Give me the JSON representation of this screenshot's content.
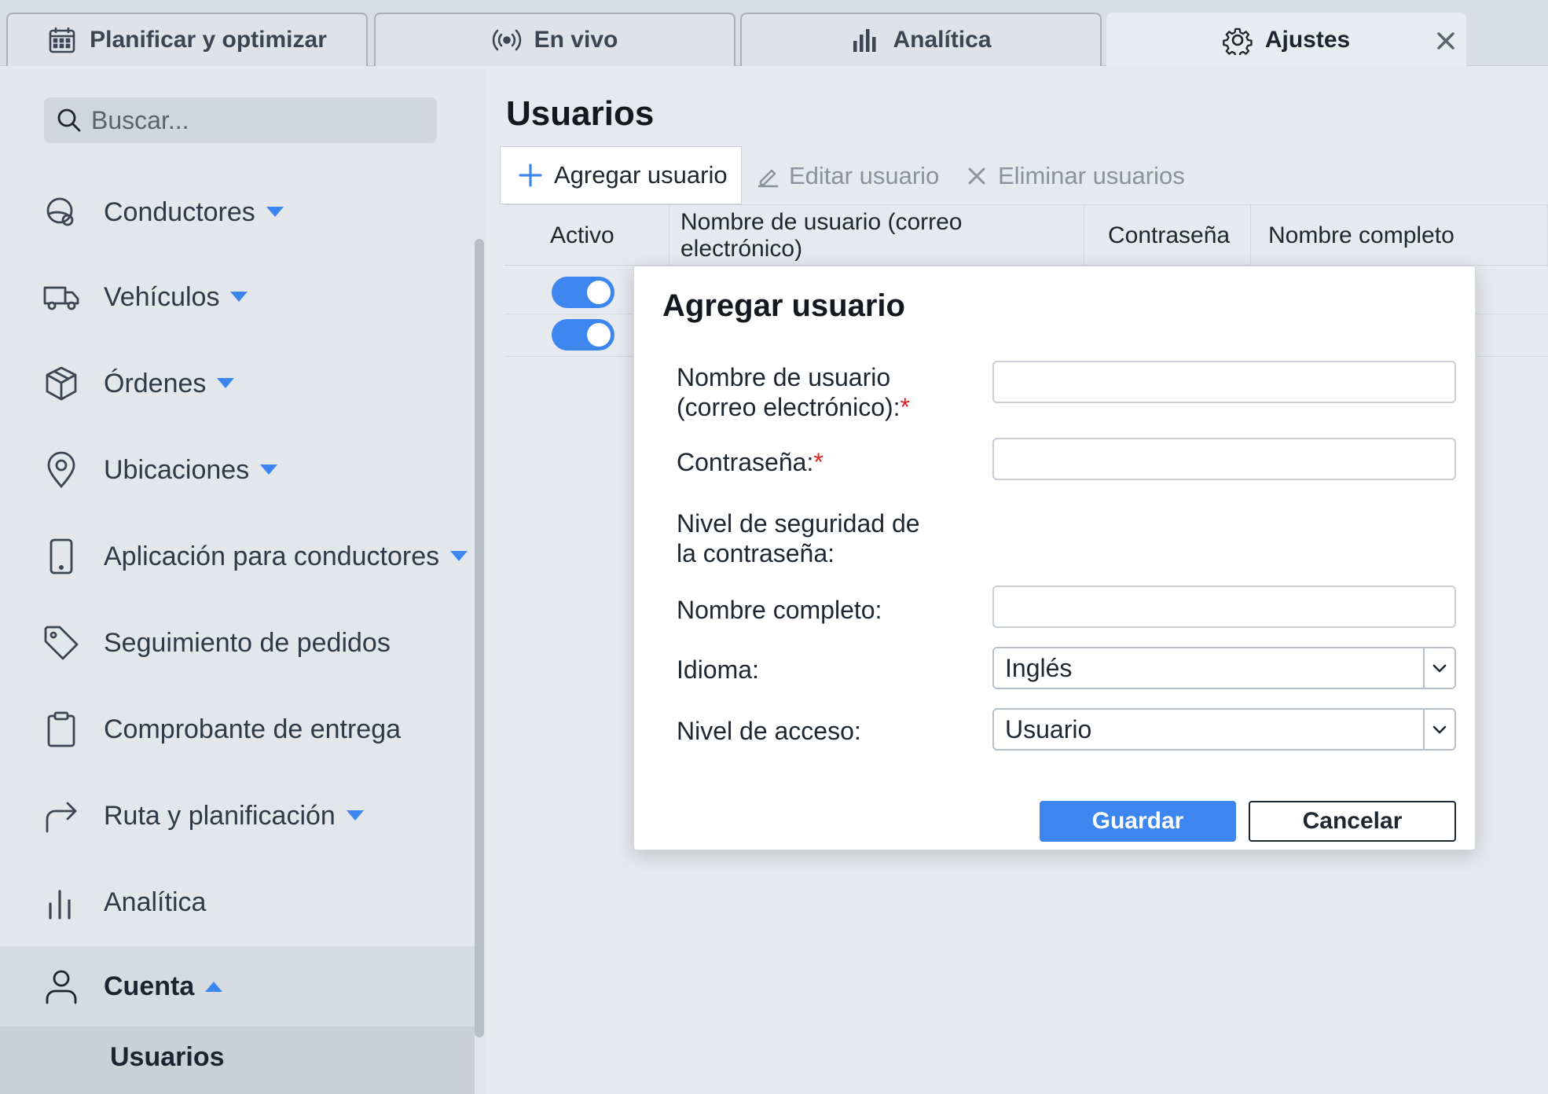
{
  "tabs": [
    {
      "label": "Planificar y optimizar",
      "icon": "calendar-icon"
    },
    {
      "label": "En vivo",
      "icon": "broadcast-icon"
    },
    {
      "label": "Analítica",
      "icon": "bar-chart-icon"
    },
    {
      "label": "Ajustes",
      "icon": "gear-icon",
      "active": true
    }
  ],
  "sidebar": {
    "search_placeholder": "Buscar...",
    "items": [
      {
        "label": "Conductores",
        "icon": "steering-icon"
      },
      {
        "label": "Vehículos",
        "icon": "truck-icon"
      },
      {
        "label": "Órdenes",
        "icon": "package-icon"
      },
      {
        "label": "Ubicaciones",
        "icon": "location-pin-icon"
      },
      {
        "label": "Aplicación para conductores",
        "icon": "mobile-icon"
      },
      {
        "label": "Seguimiento de pedidos",
        "icon": "tag-icon"
      },
      {
        "label": "Comprobante de entrega",
        "icon": "clipboard-icon"
      },
      {
        "label": "Ruta y planificación",
        "icon": "route-arrow-icon"
      },
      {
        "label": "Analítica",
        "icon": "bar-chart-icon"
      },
      {
        "label": "Cuenta",
        "icon": "user-icon"
      }
    ],
    "sub_item": "Usuarios"
  },
  "main": {
    "title": "Usuarios",
    "toolbar": {
      "add": "Agregar usuario",
      "edit": "Editar usuario",
      "delete": "Eliminar usuarios"
    },
    "columns": [
      "Activo",
      "Nombre de usuario (correo electrónico)",
      "Contraseña",
      "Nombre completo"
    ]
  },
  "dialog": {
    "title": "Agregar usuario",
    "username_label": "Nombre de usuario (correo electrónico):",
    "password_label": "Contraseña:",
    "strength_label": "Nivel de seguridad de la contraseña:",
    "fullname_label": "Nombre completo:",
    "language_label": "Idioma:",
    "language_value": "Inglés",
    "access_label": "Nivel de acceso:",
    "access_value": "Usuario",
    "required_mark": "*",
    "save": "Guardar",
    "cancel": "Cancelar"
  },
  "colors": {
    "accent": "#3d86f0",
    "required": "#e02020"
  }
}
